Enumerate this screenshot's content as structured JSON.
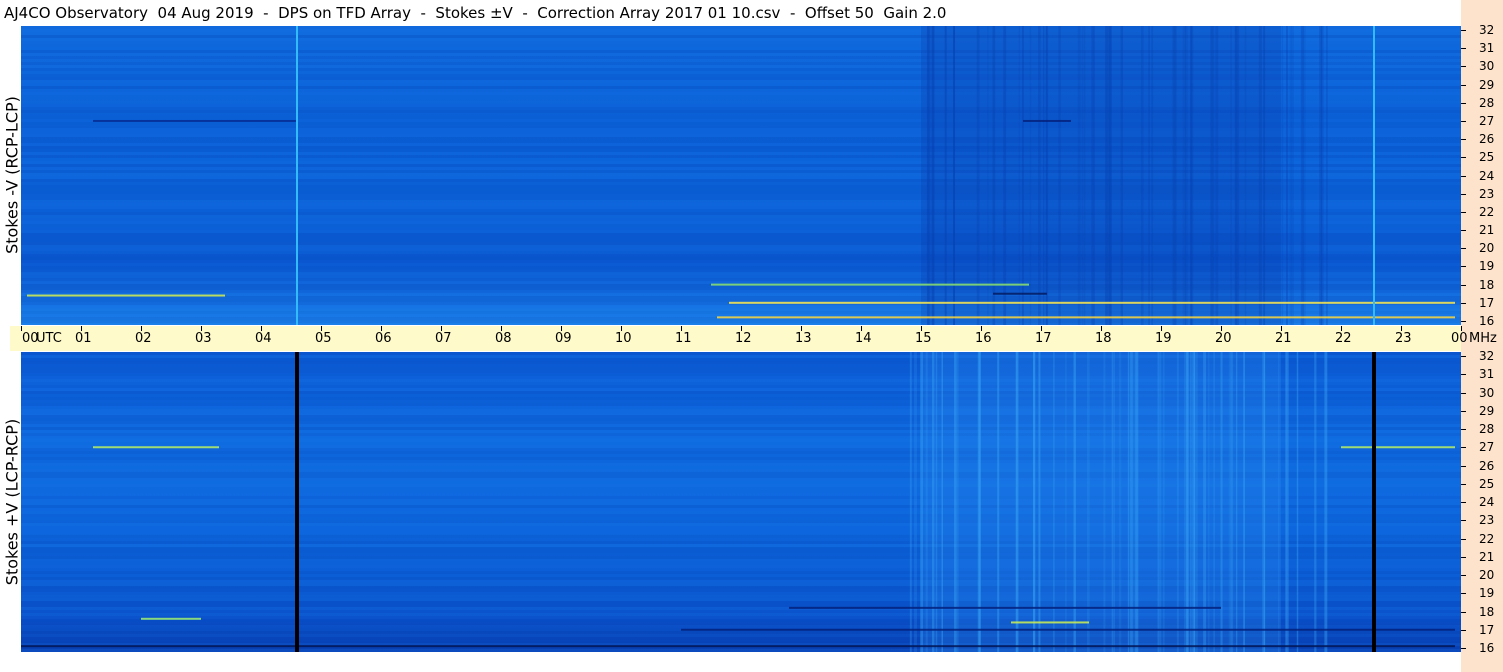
{
  "title": "AJ4CO Observatory  04 Aug 2019  -  DPS on TFD Array  -  Stokes ±V  -  Correction Array 2017 01 10.csv  -  Offset 50  Gain 2.0",
  "chart_data": {
    "type": "heatmap",
    "title": "AJ4CO Observatory  04 Aug 2019  -  DPS on TFD Array  -  Stokes ±V  -  Correction Array 2017 01 10.csv  -  Offset 50  Gain 2.0",
    "x_axis": {
      "unit_label": "UTC",
      "ticks": [
        "00",
        "01",
        "02",
        "03",
        "04",
        "05",
        "06",
        "07",
        "08",
        "09",
        "10",
        "11",
        "12",
        "13",
        "14",
        "15",
        "16",
        "17",
        "18",
        "19",
        "20",
        "21",
        "22",
        "23",
        "00"
      ],
      "range_hours": [
        0,
        24
      ]
    },
    "y_axis": {
      "unit_label": "MHz",
      "ticks": [
        32,
        31,
        30,
        29,
        28,
        27,
        26,
        25,
        24,
        23,
        22,
        21,
        20,
        19,
        18,
        17,
        16
      ],
      "range_mhz": [
        16,
        32
      ]
    },
    "panels": [
      {
        "name": "Stokes -V (RCP-LCP)",
        "colormap": "blue",
        "vertical_lines_utc": [
          4.6,
          22.55
        ],
        "line_color": "#33bbff"
      },
      {
        "name": "Stokes +V (LCP-RCP)",
        "colormap": "blue",
        "vertical_lines_utc": [
          4.6,
          22.55
        ],
        "line_color": "#000000"
      }
    ],
    "colors": {
      "background_low": "#083fb4",
      "background_mid": "#0f69dd",
      "background_high": "#1b80ea",
      "signal": "#ffee33",
      "axis_band": "#fffac9",
      "freq_band": "#fde3cc"
    }
  }
}
